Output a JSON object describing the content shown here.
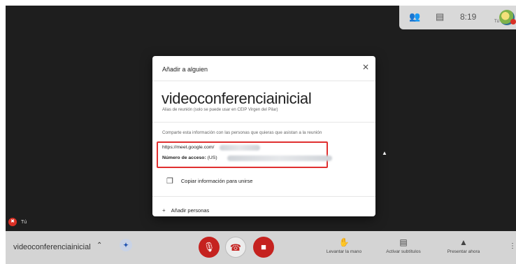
{
  "topbar": {
    "people_icon": "people-icon",
    "chat_icon": "chat-icon",
    "time": "8:19",
    "user_short": "Tú"
  },
  "self_view": {
    "label": "Tú"
  },
  "dialog": {
    "title": "Añadir a alguien",
    "meeting_name": "videoconferenciainicial",
    "alias_note": "Alias de reunión (solo se puede usar en CEIP Virgen del Pilar)",
    "share_text": "Comparte esta información con las personas que quieras que asistan a la reunión",
    "url_prefix": "https://meet.google.com/",
    "access_label": "Número de acceso:",
    "access_region": "(US)",
    "copy_label": "Copiar información para unirse",
    "add_label": "Añadir personas"
  },
  "bottombar": {
    "meeting_name": "videoconferenciainicial",
    "actions": {
      "raise_hand": "Levantar la mano",
      "captions": "Activar subtítulos",
      "present": "Presentar ahora"
    }
  },
  "colors": {
    "accent_red": "#c5221f",
    "highlight_red": "#e03030",
    "stage_bg": "#1e1e1e"
  }
}
